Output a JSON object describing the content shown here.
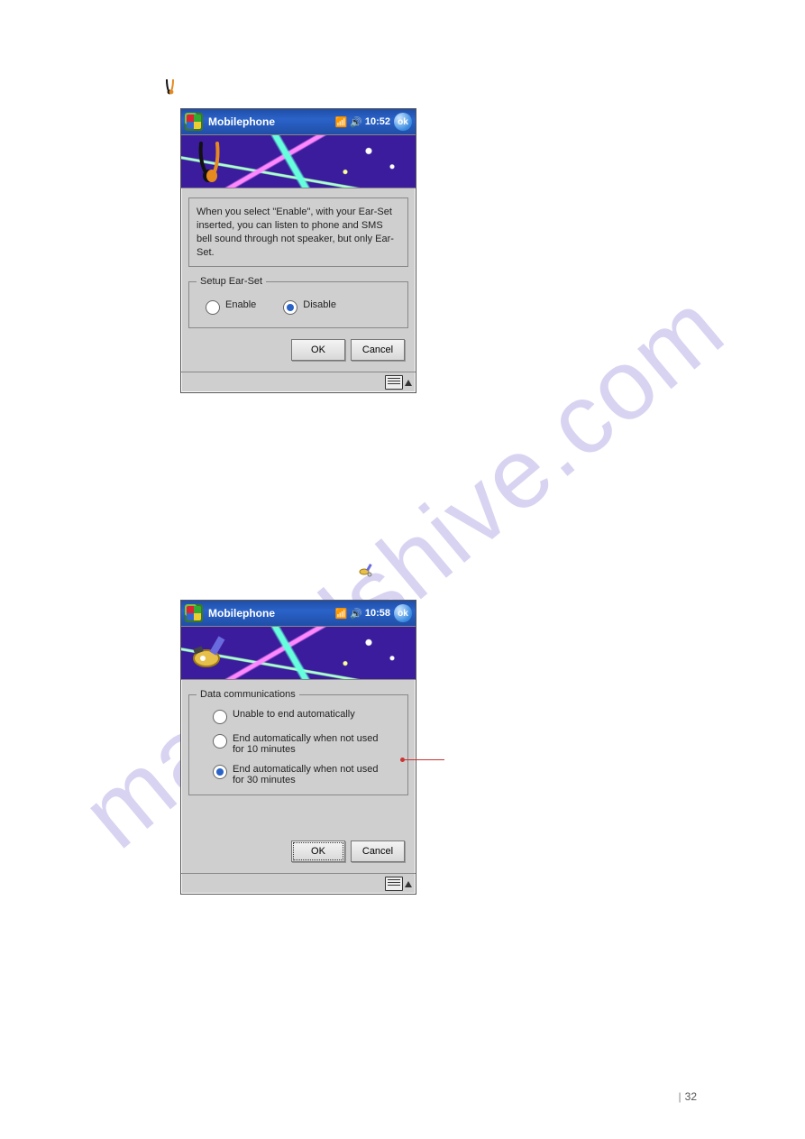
{
  "page": {
    "num": "32"
  },
  "icons": {
    "earset": "earset-icon",
    "satellite": "satellite-icon"
  },
  "shot1": {
    "title": "Mobilephone",
    "time": "10:52",
    "ok": "ok",
    "info": "When you select \"Enable\", with your Ear-Set inserted, you can listen to phone and SMS bell sound through not speaker, but only Ear-Set.",
    "group": "Setup Ear-Set",
    "enable": "Enable",
    "disable": "Disable",
    "ok_btn": "OK",
    "cancel": "Cancel"
  },
  "shot2": {
    "title": "Mobilephone",
    "time": "10:58",
    "ok": "ok",
    "group": "Data communications",
    "opt1": "Unable to end automatically",
    "opt2": "End automatically when not used for 10 minutes",
    "opt3": "End automatically when not used for 30 minutes",
    "ok_btn": "OK",
    "cancel": "Cancel"
  }
}
